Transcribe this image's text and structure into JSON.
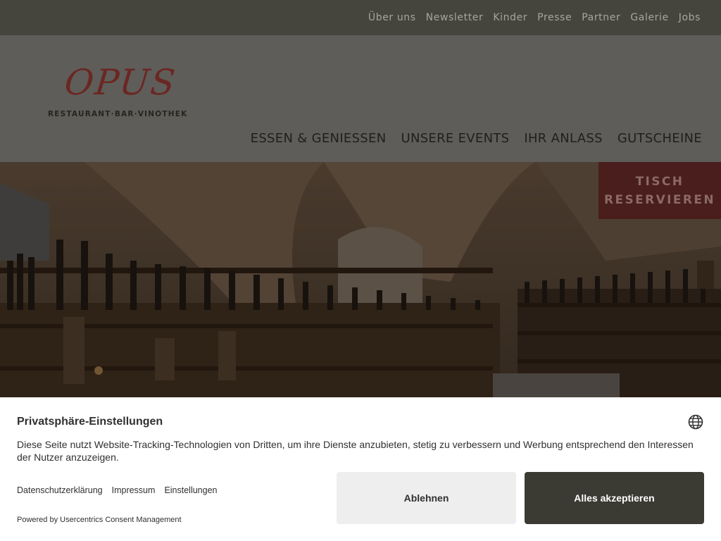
{
  "topnav": {
    "items": [
      "Über uns",
      "Newsletter",
      "Kinder",
      "Presse",
      "Partner",
      "Galerie",
      "Jobs"
    ]
  },
  "logo": {
    "wordmark": "OPUS",
    "tagline": "RESTAURANT·BAR·VINOTHEK"
  },
  "mainnav": {
    "items": [
      "ESSEN & GENIESSEN",
      "UNSERE EVENTS",
      "IHR ANLASS",
      "GUTSCHEINE"
    ]
  },
  "reserve": {
    "line1": "TISCH",
    "line2": "RESERVIEREN"
  },
  "consent": {
    "title": "Privatsphäre-Einstellungen",
    "text": "Diese Seite nutzt Website-Tracking-Technologien von Dritten, um ihre Dienste anzubieten, stetig zu verbessern und Werbung entsprechend den Interessen der Nutzer anzuzeigen.",
    "links": [
      "Datenschutzerklärung",
      "Impressum",
      "Einstellungen"
    ],
    "deny_label": "Ablehnen",
    "accept_label": "Alles akzeptieren",
    "powered_by": "Powered by Usercentrics Consent Management",
    "language_icon": "globe-icon"
  },
  "colors": {
    "topbar": "#45443d",
    "header_overlay": "#5e5d59",
    "reserve": "#491e1c",
    "accept_button": "#3c3b33",
    "deny_button": "#eeeeee"
  }
}
